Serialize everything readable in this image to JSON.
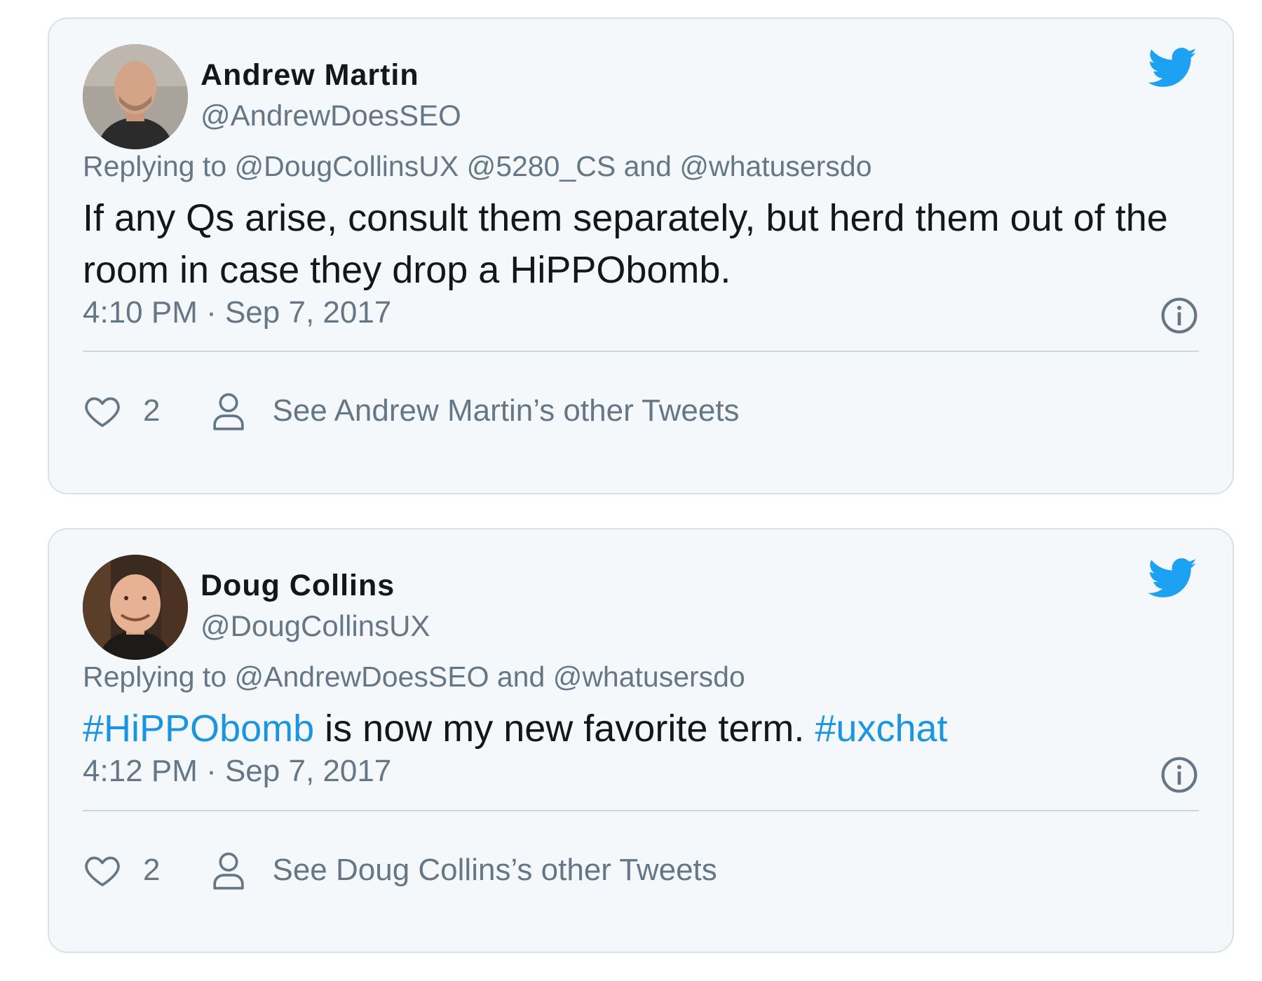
{
  "tweets": [
    {
      "author_name": "Andrew Martin",
      "author_handle": "@AndrewDoesSEO",
      "replying_prefix": "Replying to",
      "replying_to": [
        "@DougCollinsUX",
        "@5280_CS"
      ],
      "replying_and": "and",
      "replying_last": "@whatusersdo",
      "body_text": "If any Qs arise, consult them separately, but herd them out of the room in case they drop a HiPPObomb.",
      "timestamp": "4:10 PM · Sep 7, 2017",
      "like_count": "2",
      "other_tweets_label": "See Andrew Martin’s other Tweets"
    },
    {
      "author_name": "Doug Collins",
      "author_handle": "@DougCollinsUX",
      "replying_prefix": "Replying to",
      "replying_to": [
        "@AndrewDoesSEO"
      ],
      "replying_and": "and",
      "replying_last": "@whatusersdo",
      "body_hashtag_1": "#HiPPObomb",
      "body_text": " is now my new favorite term. ",
      "body_hashtag_2": "#uxchat",
      "timestamp": "4:12 PM · Sep 7, 2017",
      "like_count": "2",
      "other_tweets_label": "See Doug Collins’s other Tweets"
    }
  ],
  "icons": {
    "brand": "twitter-bird-icon",
    "info": "info-circle-icon",
    "like": "heart-outline-icon",
    "profile": "person-outline-icon"
  },
  "colors": {
    "card_background": "#f5f8fa",
    "card_border": "#d9e1e8",
    "twitter_blue": "#1da1f2",
    "hashtag_blue": "#1b95e0",
    "secondary_text": "#657786",
    "primary_text": "#14171a"
  }
}
